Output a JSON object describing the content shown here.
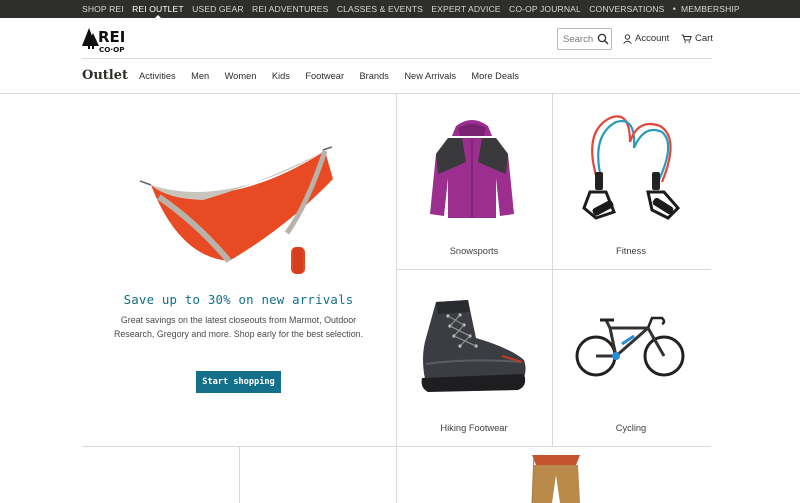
{
  "topbar": {
    "links": [
      "SHOP REI",
      "REI OUTLET",
      "USED GEAR",
      "REI ADVENTURES",
      "CLASSES & EVENTS",
      "EXPERT ADVICE",
      "CO-OP JOURNAL",
      "CONVERSATIONS"
    ],
    "separator": "•",
    "membership": "MEMBERSHIP",
    "active_index": 1
  },
  "header": {
    "logo_text": "REI",
    "logo_subtext": "CO·OP",
    "search_placeholder": "Search",
    "account_label": "Account",
    "cart_label": "Cart"
  },
  "catnav": {
    "title": "Outlet",
    "items": [
      "Activities",
      "Men",
      "Women",
      "Kids",
      "Footwear",
      "Brands",
      "New Arrivals",
      "More Deals"
    ]
  },
  "hero": {
    "title": "Save up to 30% on new arrivals",
    "text": "Great savings on the latest closeouts from Marmot, Outdoor Research, Gregory and more. Shop early for the best selection.",
    "cta": "Start shopping",
    "image_icon": "hammock-image"
  },
  "tiles": [
    {
      "label": "Snowsports",
      "icon": "jacket-image"
    },
    {
      "label": "Fitness",
      "icon": "resistance-bands-image"
    },
    {
      "label": "Hiking Footwear",
      "icon": "hiking-boot-image"
    },
    {
      "label": "Cycling",
      "icon": "bicycle-image"
    }
  ],
  "colors": {
    "topbar_bg": "#2e2e2b",
    "accent": "#14708a",
    "text": "#2e2e2b",
    "rule": "#d9d9d5"
  }
}
